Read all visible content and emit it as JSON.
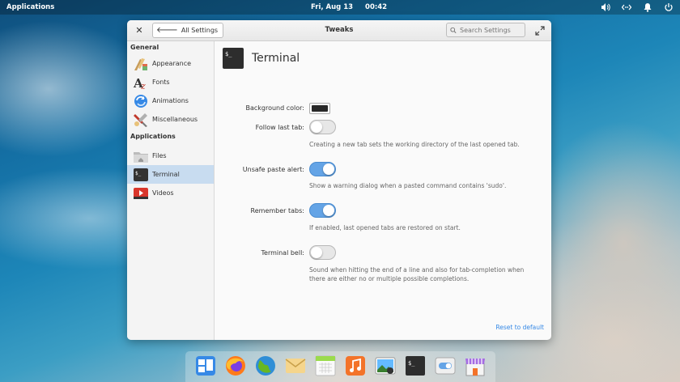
{
  "panel": {
    "applications_label": "Applications",
    "date": "Fri, Aug 13",
    "time": "00:42",
    "indicators": [
      "sound-icon",
      "network-icon",
      "notifications-icon",
      "power-icon"
    ]
  },
  "window": {
    "title": "Tweaks",
    "back_button_label": "All Settings",
    "search_placeholder": "Search Settings"
  },
  "sidebar": {
    "general_header": "General",
    "general_items": [
      {
        "label": "Appearance",
        "icon": "appearance-icon"
      },
      {
        "label": "Fonts",
        "icon": "fonts-icon"
      },
      {
        "label": "Animations",
        "icon": "animations-icon"
      },
      {
        "label": "Miscellaneous",
        "icon": "miscellaneous-icon"
      }
    ],
    "applications_header": "Applications",
    "application_items": [
      {
        "label": "Files",
        "icon": "files-icon"
      },
      {
        "label": "Terminal",
        "icon": "terminal-icon",
        "selected": true
      },
      {
        "label": "Videos",
        "icon": "videos-icon"
      }
    ]
  },
  "page": {
    "title": "Terminal",
    "settings": {
      "background_color": {
        "label": "Background color:",
        "value": "#282828"
      },
      "follow_last_tab": {
        "label": "Follow last tab:",
        "enabled": false,
        "description": "Creating a new tab sets the working directory of the last opened tab."
      },
      "unsafe_paste_alert": {
        "label": "Unsafe paste alert:",
        "enabled": true,
        "description": "Show a warning dialog when a pasted command contains 'sudo'."
      },
      "remember_tabs": {
        "label": "Remember tabs:",
        "enabled": true,
        "description": "If enabled, last opened tabs are restored on start."
      },
      "terminal_bell": {
        "label": "Terminal bell:",
        "enabled": false,
        "description": "Sound when hitting the end of a line and also for tab-completion when there are either no or multiple possible completions."
      }
    },
    "reset_label": "Reset to default"
  },
  "dock": {
    "items": [
      "multitasking-view-icon",
      "firefox-icon",
      "web-browser-icon",
      "mail-icon",
      "calendar-icon",
      "music-icon",
      "photos-icon",
      "terminal-icon",
      "settings-toggle-icon",
      "appcenter-icon"
    ]
  },
  "colors": {
    "accent": "#3689e6",
    "toggle_on": "#64a4e6",
    "selected_row": "#c8dcf0"
  }
}
